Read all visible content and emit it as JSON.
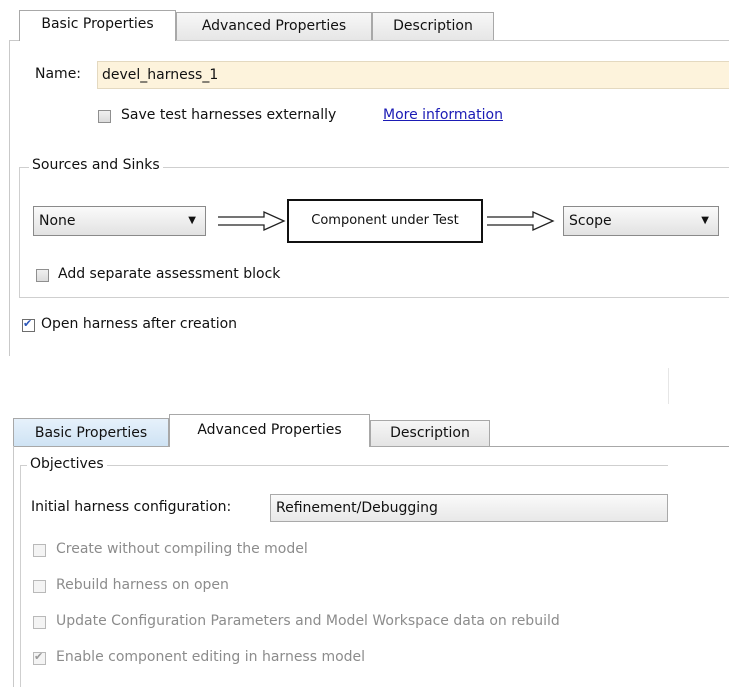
{
  "panel1": {
    "tabs": [
      {
        "label": "Basic Properties",
        "active": true
      },
      {
        "label": "Advanced Properties",
        "active": false
      },
      {
        "label": "Description",
        "active": false
      }
    ],
    "name_label": "Name:",
    "name_value": "devel_harness_1",
    "save_externally_label": "Save test harnesses externally",
    "save_externally_checked": false,
    "more_info_link": "More information",
    "sources_group_title": "Sources and Sinks",
    "source_select_value": "None",
    "component_label": "Component under Test",
    "sink_select_value": "Scope",
    "assessment_label": "Add separate assessment block",
    "assessment_checked": false,
    "open_harness_label": "Open harness after creation",
    "open_harness_checked": true
  },
  "panel2": {
    "tabs": [
      {
        "label": "Basic Properties",
        "active": false
      },
      {
        "label": "Advanced Properties",
        "active": true
      },
      {
        "label": "Description",
        "active": false
      }
    ],
    "objectives_title": "Objectives",
    "initial_config_label": "Initial harness configuration:",
    "initial_config_value": "Refinement/Debugging",
    "options": [
      {
        "label": "Create without compiling the model",
        "checked": false,
        "enabled": false
      },
      {
        "label": "Rebuild harness on open",
        "checked": false,
        "enabled": false
      },
      {
        "label": "Update Configuration Parameters and Model Workspace data on rebuild",
        "checked": false,
        "enabled": false
      },
      {
        "label": "Enable component editing in harness model",
        "checked": true,
        "enabled": false
      }
    ]
  },
  "icons": {
    "dropdown_caret": "caret-down-icon",
    "flow_arrow": "right-arrow-icon",
    "checkmark": "checkmark-icon"
  }
}
